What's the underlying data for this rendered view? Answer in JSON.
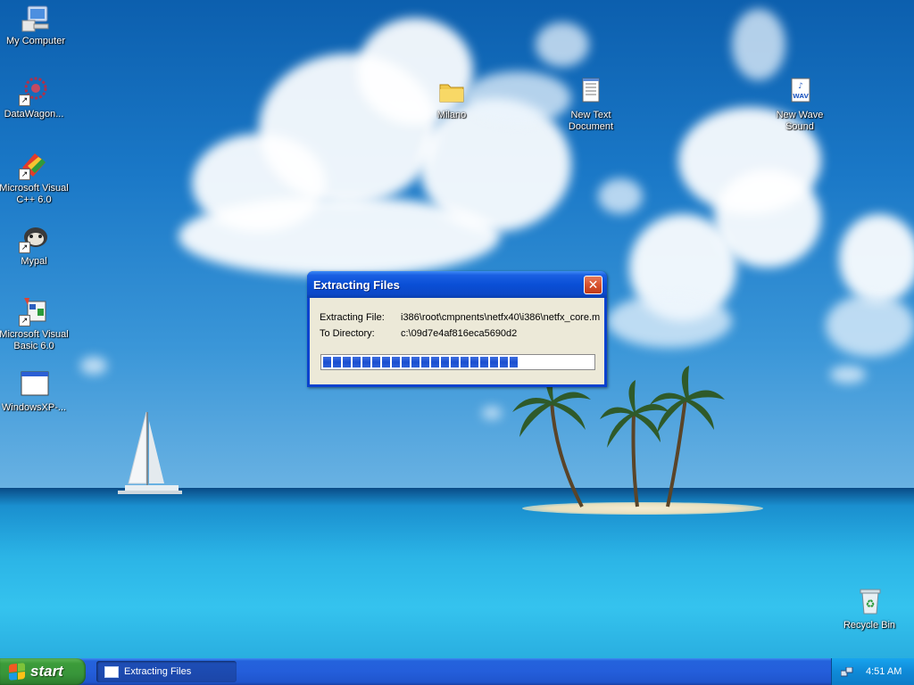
{
  "desktop": {
    "icons": [
      {
        "id": "my-computer",
        "label": "My Computer"
      },
      {
        "id": "datawagon",
        "label": "DataWagon..."
      },
      {
        "id": "visual-cpp",
        "label": "Microsoft Visual C++ 6.0"
      },
      {
        "id": "mypal",
        "label": "Mypal"
      },
      {
        "id": "visual-basic",
        "label": "Microsoft Visual Basic 6.0"
      },
      {
        "id": "windowsxp",
        "label": "WindowsXP-..."
      },
      {
        "id": "milano",
        "label": "Milano"
      },
      {
        "id": "new-text-document",
        "label": "New Text Document"
      },
      {
        "id": "new-wave-sound",
        "label": "New Wave Sound"
      },
      {
        "id": "recycle-bin",
        "label": "Recycle Bin"
      }
    ]
  },
  "dialog": {
    "title": "Extracting Files",
    "close_glyph": "✕",
    "extracting_label": "Extracting File:",
    "extracting_value": "i386\\root\\cmpnents\\netfx40\\i386\\netfx_core.m",
    "directory_label": "To Directory:",
    "directory_value": "c:\\09d7e4af816eca5690d2",
    "progress_fraction": 0.74
  },
  "taskbar": {
    "start_label": "start",
    "task_button_label": "Extracting Files",
    "clock": "4:51 AM"
  },
  "colors": {
    "xp_blue": "#245edb",
    "start_green": "#3c9c3a",
    "close_red": "#d8522e",
    "dialog_face": "#ece9d8",
    "progress_blue": "#1b4fd0"
  }
}
